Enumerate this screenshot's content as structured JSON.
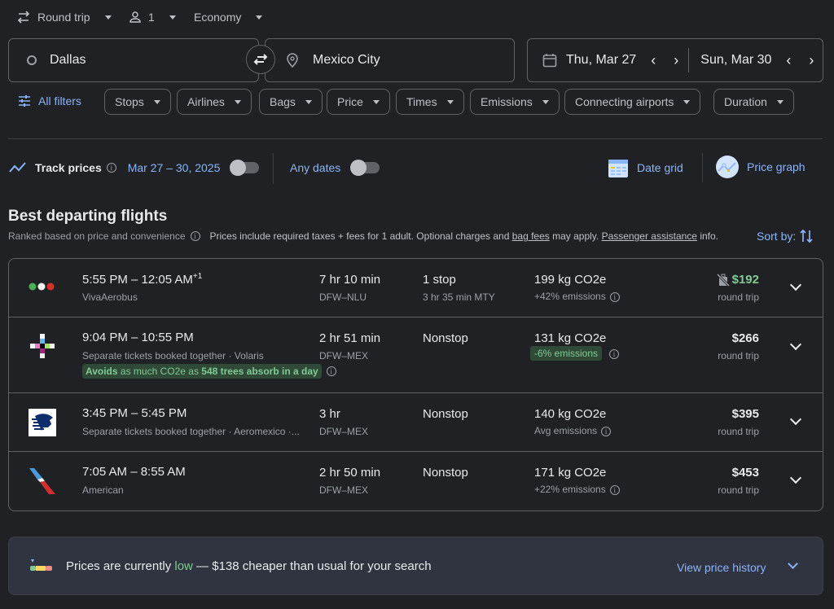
{
  "top_bar": {
    "trip_type": "Round trip",
    "passengers": "1",
    "cabin_class": "Economy"
  },
  "search": {
    "origin": "Dallas",
    "destination": "Mexico City",
    "depart_date": "Thu, Mar 27",
    "return_date": "Sun, Mar 30"
  },
  "filters": {
    "all_filters": "All filters",
    "chips": [
      "Stops",
      "Airlines",
      "Bags",
      "Price",
      "Times",
      "Emissions",
      "Connecting airports",
      "Duration"
    ]
  },
  "tracking": {
    "track_prices_label": "Track prices",
    "date_range": "Mar 27 – 30, 2025",
    "date_range_toggle": false,
    "any_dates_label": "Any dates",
    "any_dates_toggle": false,
    "date_grid_label": "Date grid",
    "price_graph_label": "Price graph"
  },
  "results": {
    "title": "Best departing flights",
    "ranked_note": "Ranked based on price and convenience",
    "prices_note_prefix": "Prices include required taxes + fees for 1 adult. Optional charges and ",
    "bag_fees_link": "bag fees",
    "prices_note_mid": " may apply. ",
    "passenger_assistance_link": "Passenger assistance",
    "prices_note_suffix": " info.",
    "sort_by": "Sort by:",
    "flights": [
      {
        "times": "5:55 PM – 12:05 AM",
        "day_offset": "+1",
        "airline": "VivaAerobus",
        "duration": "7 hr 10 min",
        "route": "DFW–NLU",
        "stops": "1 stop",
        "layover": "3 hr 35 min MTY",
        "emissions": "199 kg CO2e",
        "emissions_note": "+42% emissions",
        "price": "$192",
        "price_type": "round trip",
        "price_color": "#81c995"
      },
      {
        "times": "9:04 PM – 10:55 PM",
        "day_offset": "",
        "airline": "Separate tickets booked together · Volaris",
        "eco_badge_1": "Avoids",
        "eco_badge_2": " as much CO2e as ",
        "eco_badge_3": "548 trees absorb in a day",
        "duration": "2 hr 51 min",
        "route": "DFW–MEX",
        "stops": "Nonstop",
        "layover": "",
        "emissions": "131 kg CO2e",
        "emissions_note": "-6% emissions",
        "price": "$266",
        "price_type": "round trip",
        "price_color": "#e8eaed"
      },
      {
        "times": "3:45 PM – 5:45 PM",
        "day_offset": "",
        "airline": "Separate tickets booked together · Aeromexico ·...",
        "duration": "3 hr",
        "route": "DFW–MEX",
        "stops": "Nonstop",
        "layover": "",
        "emissions": "140 kg CO2e",
        "emissions_note": "Avg emissions",
        "price": "$395",
        "price_type": "round trip",
        "price_color": "#e8eaed"
      },
      {
        "times": "7:05 AM – 8:55 AM",
        "day_offset": "",
        "airline": "American",
        "duration": "2 hr 50 min",
        "route": "DFW–MEX",
        "stops": "Nonstop",
        "layover": "",
        "emissions": "171 kg CO2e",
        "emissions_note": "+22% emissions",
        "price": "$453",
        "price_type": "round trip",
        "price_color": "#e8eaed"
      }
    ]
  },
  "price_insight": {
    "prefix": "Prices are currently ",
    "level": "low",
    "suffix": " — $138 cheaper than usual for your search",
    "view_history": "View price history"
  }
}
